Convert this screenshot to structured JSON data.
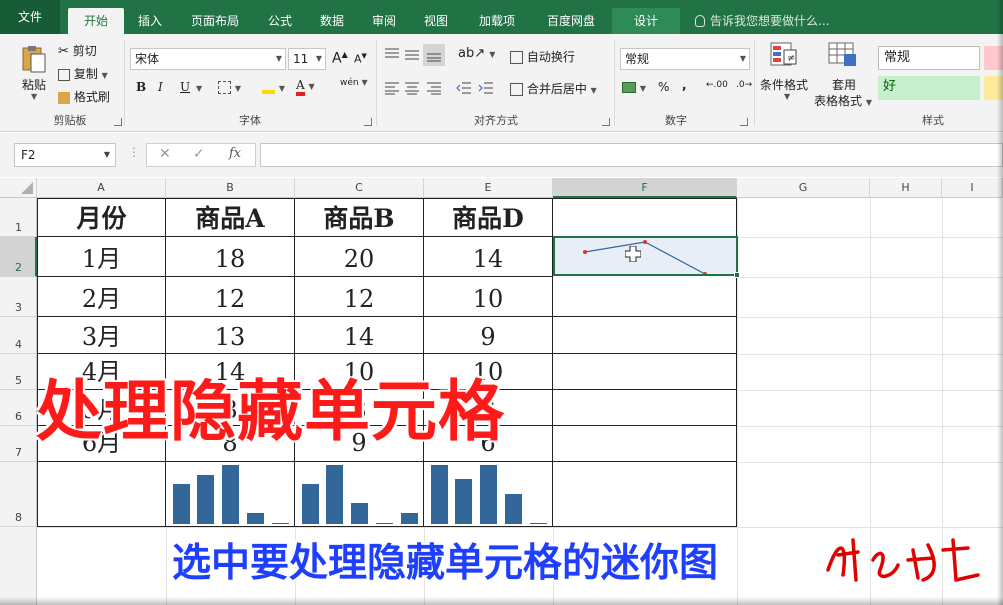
{
  "ribbon_tabs": {
    "file": "文件",
    "home": "开始",
    "insert": "插入",
    "page_layout": "页面布局",
    "formulas": "公式",
    "data": "数据",
    "review": "审阅",
    "view": "视图",
    "addins": "加载项",
    "baidu": "百度网盘",
    "design": "设计",
    "tell_me": "告诉我您想要做什么..."
  },
  "clipboard": {
    "paste": "粘贴",
    "cut": "剪切",
    "copy": "复制",
    "format_painter": "格式刷",
    "label": "剪贴板"
  },
  "font": {
    "name": "宋体",
    "size": "11",
    "grow": "A",
    "shrink": "A",
    "bold": "B",
    "italic": "I",
    "underline": "U",
    "phonetic": "wén",
    "label": "字体"
  },
  "alignment": {
    "wrap_text": "自动换行",
    "merge_center": "合并后居中",
    "label": "对齐方式"
  },
  "number": {
    "format": "常规",
    "percent": "%",
    "comma": ",",
    "inc_decimal": ".00",
    "dec_decimal": ".0",
    "label": "数字"
  },
  "styles": {
    "conditional": "条件格式",
    "table_format_1": "套用",
    "table_format_2": "表格格式",
    "normal": "常规",
    "good": "好",
    "label": "样式"
  },
  "formula_bar": {
    "name_box": "F2",
    "fx": "fx",
    "value": ""
  },
  "columns": [
    "A",
    "B",
    "C",
    "E",
    "F",
    "G",
    "H",
    "I"
  ],
  "rows": [
    "1",
    "2",
    "3",
    "4",
    "5",
    "6",
    "7",
    "8"
  ],
  "table": {
    "headers": [
      "月份",
      "商品A",
      "商品B",
      "商品D"
    ],
    "body": [
      [
        "1月",
        "18",
        "20",
        "14"
      ],
      [
        "2月",
        "12",
        "12",
        "10"
      ],
      [
        "3月",
        "13",
        "14",
        "9"
      ],
      [
        "4月",
        "14",
        "10",
        "10"
      ],
      [
        "5月",
        "8",
        "8",
        "8"
      ],
      [
        "6月",
        "8",
        "9",
        "6"
      ]
    ]
  },
  "overlay": {
    "title": "处理隐藏单元格",
    "subtitle": "选中要处理隐藏单元格的迷你图"
  },
  "colors": {
    "excel_green": "#217346",
    "sparkline": "#336699",
    "marker": "#e03030",
    "overlay_red": "#ff1a1a",
    "overlay_blue": "#1f3fff"
  }
}
